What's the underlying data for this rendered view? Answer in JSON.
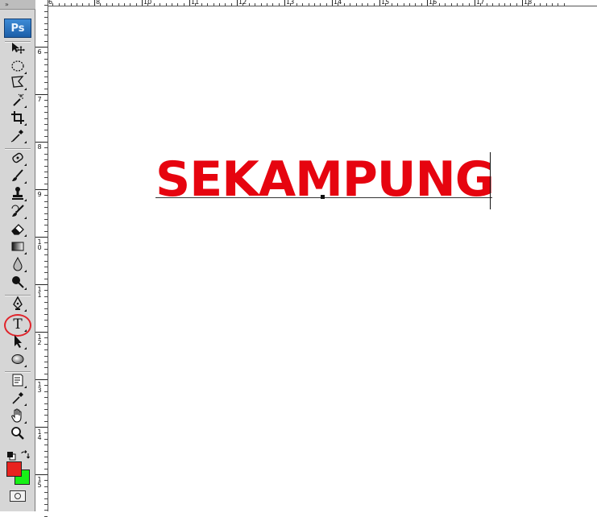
{
  "toolbox": {
    "collapse_glyph": "»",
    "logo": "Ps",
    "tools": [
      {
        "name": "move-icon"
      },
      {
        "name": "elliptical-marquee-icon"
      },
      {
        "name": "polygonal-lasso-icon"
      },
      {
        "name": "magic-wand-icon"
      },
      {
        "name": "crop-icon"
      },
      {
        "name": "eyedropper-icon"
      },
      {
        "name": "spot-healing-icon"
      },
      {
        "name": "brush-icon"
      },
      {
        "name": "clone-stamp-icon"
      },
      {
        "name": "history-brush-icon"
      },
      {
        "name": "eraser-icon"
      },
      {
        "name": "gradient-icon"
      },
      {
        "name": "blur-icon"
      },
      {
        "name": "dodge-icon"
      },
      {
        "name": "pen-icon"
      },
      {
        "name": "type-icon"
      },
      {
        "name": "path-selection-icon"
      },
      {
        "name": "ellipse-shape-icon"
      },
      {
        "name": "notes-icon"
      },
      {
        "name": "color-sampler-icon"
      },
      {
        "name": "hand-icon"
      },
      {
        "name": "zoom-icon"
      }
    ],
    "active_tool": "type-icon",
    "highlight_color": "#e0242b",
    "foreground_color": "#e8231f",
    "background_color": "#16f016"
  },
  "rulers": {
    "horizontal_labels": [
      "6",
      "8",
      "10",
      "11",
      "12",
      "13",
      "14",
      "15",
      "16",
      "17",
      "18"
    ],
    "vertical_labels": [
      "6",
      "7",
      "8",
      "9",
      "10",
      "11",
      "12",
      "13",
      "14",
      "15"
    ]
  },
  "canvas": {
    "text": "SEKAMPUNG",
    "text_color": "#e6040f"
  }
}
